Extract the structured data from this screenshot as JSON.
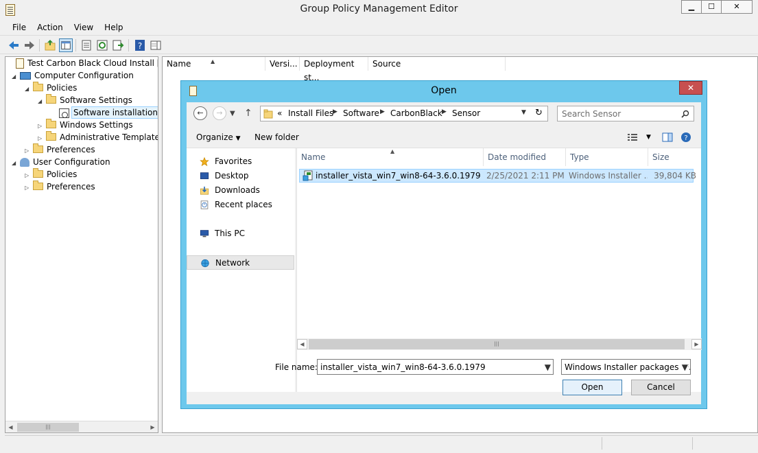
{
  "window": {
    "title": "Group Policy Management Editor"
  },
  "menu": [
    "File",
    "Action",
    "View",
    "Help"
  ],
  "tree": [
    {
      "label": "Test Carbon Black Cloud Install [PROD",
      "icon": "policy-doc-icon",
      "expander": ""
    },
    {
      "label": "Computer Configuration",
      "icon": "computer-icon",
      "expander": "◢"
    },
    {
      "label": "Policies",
      "icon": "folder-icon",
      "expander": "◢"
    },
    {
      "label": "Software Settings",
      "icon": "folder-icon",
      "expander": "◢"
    },
    {
      "label": "Software installation",
      "icon": "software-installation-icon",
      "expander": ""
    },
    {
      "label": "Windows Settings",
      "icon": "folder-icon",
      "expander": "▷"
    },
    {
      "label": "Administrative Templates:",
      "icon": "folder-icon",
      "expander": "▷"
    },
    {
      "label": "Preferences",
      "icon": "folder-icon",
      "expander": "▷"
    },
    {
      "label": "User Configuration",
      "icon": "user-icon",
      "expander": "◢"
    },
    {
      "label": "Policies",
      "icon": "folder-icon",
      "expander": "▷"
    },
    {
      "label": "Preferences",
      "icon": "folder-icon",
      "expander": "▷"
    }
  ],
  "list_columns": [
    "Name",
    "Versi...",
    "Deployment st...",
    "Source"
  ],
  "dialog": {
    "title": "Open",
    "close_label": "✕",
    "breadcrumb_prefix": "«",
    "breadcrumb": [
      "Install Files",
      "Software",
      "CarbonBlack",
      "Sensor"
    ],
    "search_placeholder": "Search Sensor",
    "organize_label": "Organize",
    "new_folder_label": "New folder",
    "nav": [
      {
        "label": "Favorites",
        "icon": "star-icon"
      },
      {
        "label": "Desktop",
        "icon": "desktop-icon"
      },
      {
        "label": "Downloads",
        "icon": "downloads-icon"
      },
      {
        "label": "Recent places",
        "icon": "recent-places-icon"
      },
      {
        "label": "This PC",
        "icon": "this-pc-icon"
      },
      {
        "label": "Network",
        "icon": "network-icon"
      }
    ],
    "columns": [
      "Name",
      "Date modified",
      "Type",
      "Size"
    ],
    "files": [
      {
        "name": "installer_vista_win7_win8-64-3.6.0.1979",
        "date": "2/25/2021 2:11 PM",
        "type": "Windows Installer ...",
        "size": "39,804 KB",
        "icon": "msi-package-icon"
      }
    ],
    "file_name_label": "File name:",
    "file_name_value": "installer_vista_win7_win8-64-3.6.0.1979",
    "file_type_value": "Windows Installer packages (*.msi)",
    "open_label": "Open",
    "cancel_label": "Cancel"
  }
}
